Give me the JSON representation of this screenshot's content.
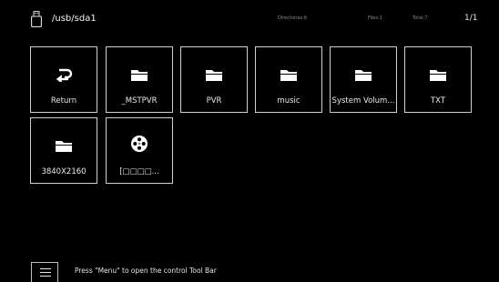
{
  "header": {
    "path": "/usb/sda1",
    "directories": "Directories:6",
    "files": "Files:1",
    "total": "Total:7",
    "page": "1/1"
  },
  "items": [
    {
      "label": "Return",
      "icon": "return-icon"
    },
    {
      "label": "_MSTPVR",
      "icon": "folder-icon"
    },
    {
      "label": "PVR",
      "icon": "folder-icon"
    },
    {
      "label": "music",
      "icon": "folder-icon"
    },
    {
      "label": "System Volum...",
      "icon": "folder-icon"
    },
    {
      "label": "TXT",
      "icon": "folder-icon"
    },
    {
      "label": "3840X2160",
      "icon": "folder-icon"
    },
    {
      "label": "[□□□□...",
      "icon": "video-reel-icon"
    }
  ],
  "footer": {
    "hint": "Press \"Menu\" to open the control Tool Bar",
    "menu_icon": "menu-icon"
  }
}
